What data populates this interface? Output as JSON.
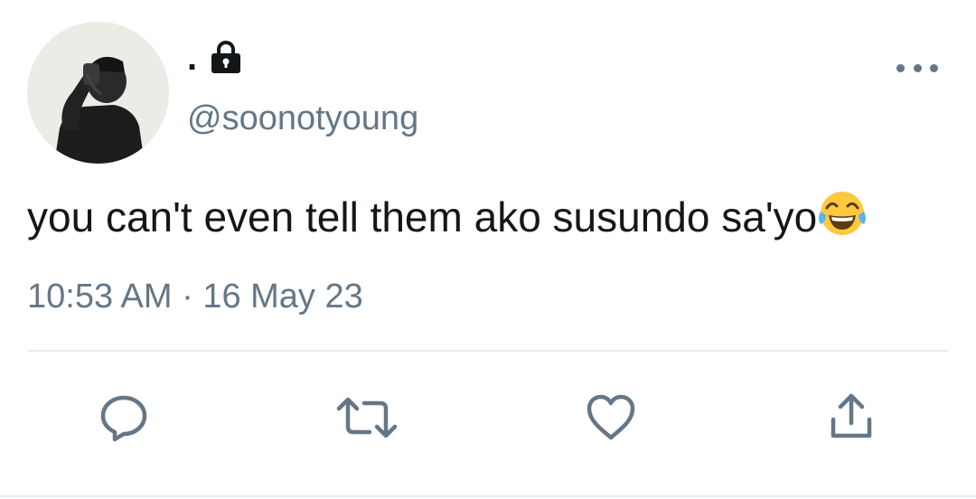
{
  "tweet": {
    "display_name": ".",
    "handle": "@soonotyoung",
    "text": "you can't even tell them ako susundo sa'yo",
    "timestamp": "10:53 AM · 16 May 23",
    "emoji": "face-with-tears-of-joy"
  },
  "icons": {
    "lock": "lock-icon",
    "more": "more-options-icon",
    "reply": "reply-icon",
    "retweet": "retweet-icon",
    "like": "heart-icon",
    "share": "share-icon"
  },
  "colors": {
    "text": "#14171a",
    "secondary": "#657786",
    "divider": "#e6ecf0"
  }
}
